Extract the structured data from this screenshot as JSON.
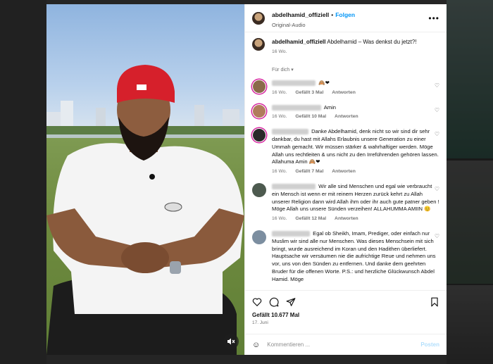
{
  "header": {
    "username": "abdelhamid_offiziell",
    "separator": "•",
    "follow_label": "Folgen",
    "audio_label": "Original-Audio",
    "more_label": "•••"
  },
  "caption": {
    "username": "abdelhamid_offiziell",
    "text": "Abdelhamid – Was denkst du jetzt?!",
    "time": "16 Wo.",
    "translate": "Für dich ▾"
  },
  "comments": [
    {
      "text": "🙈❤",
      "time": "16 Wo.",
      "likes": "Gefällt 3 Mal",
      "reply": "Antworten"
    },
    {
      "text": "Amin",
      "time": "16 Wo.",
      "likes": "Gefällt 10 Mal",
      "reply": "Antworten"
    },
    {
      "text": "Danke Abdelhamid, denk nicht so wir sind dir sehr dankbar, du hast mit Allahs Erlaubnis unsere Generation zu einer Ummah gemacht. Wir müssen stärker & wahrhaftiger werden. Möge Allah uns rechtleiten & uns nicht zu den Irreführenden gehören lassen. Allahuma Amin 🙈❤",
      "time": "16 Wo.",
      "likes": "Gefällt 7 Mal",
      "reply": "Antworten"
    },
    {
      "text": "Wir alle sind Menschen und egal wie verbraucht ein Mensch ist wenn er mit reinem Herzen zurück kehrt zu Allah unserer Religion dann wird Allah ihm oder ihr auch gute patner geben ! Möge Allah uns unsere Sünden verzeihen! ALLAHUMMA AMIIN 😊",
      "time": "16 Wo.",
      "likes": "Gefällt 12 Mal",
      "reply": "Antworten"
    },
    {
      "text": "Egal ob Sheikh, Imam, Prediger, oder einfach nur Muslim wir sind alle nur Menschen. Was dieses Menschsein mit sich bringt, wurde ausreichend im Koran und den Hadithen überliefert. Hauptsache wir versäumen nie die aufrichtige Reue und nehmen uns vor, uns von den Sünden zu entfernen. Und danke dem geehrten Bruder für die offenen Worte. P.S.: und herzliche Glückwunsch Abdel Hamid. Möge",
      "time": "",
      "likes": "",
      "reply": ""
    }
  ],
  "footer": {
    "likes": "Gefällt 10.677 Mal",
    "date": "17. Juni",
    "comment_placeholder": "Kommentieren ...",
    "post_label": "Posten"
  },
  "icons": [
    "like-heart-icon",
    "comment-icon",
    "share-icon",
    "bookmark-icon",
    "emoji-icon",
    "mute-icon",
    "more-icon"
  ],
  "colors": {
    "accent": "#0095f6",
    "post_disabled": "#b2dffc"
  }
}
